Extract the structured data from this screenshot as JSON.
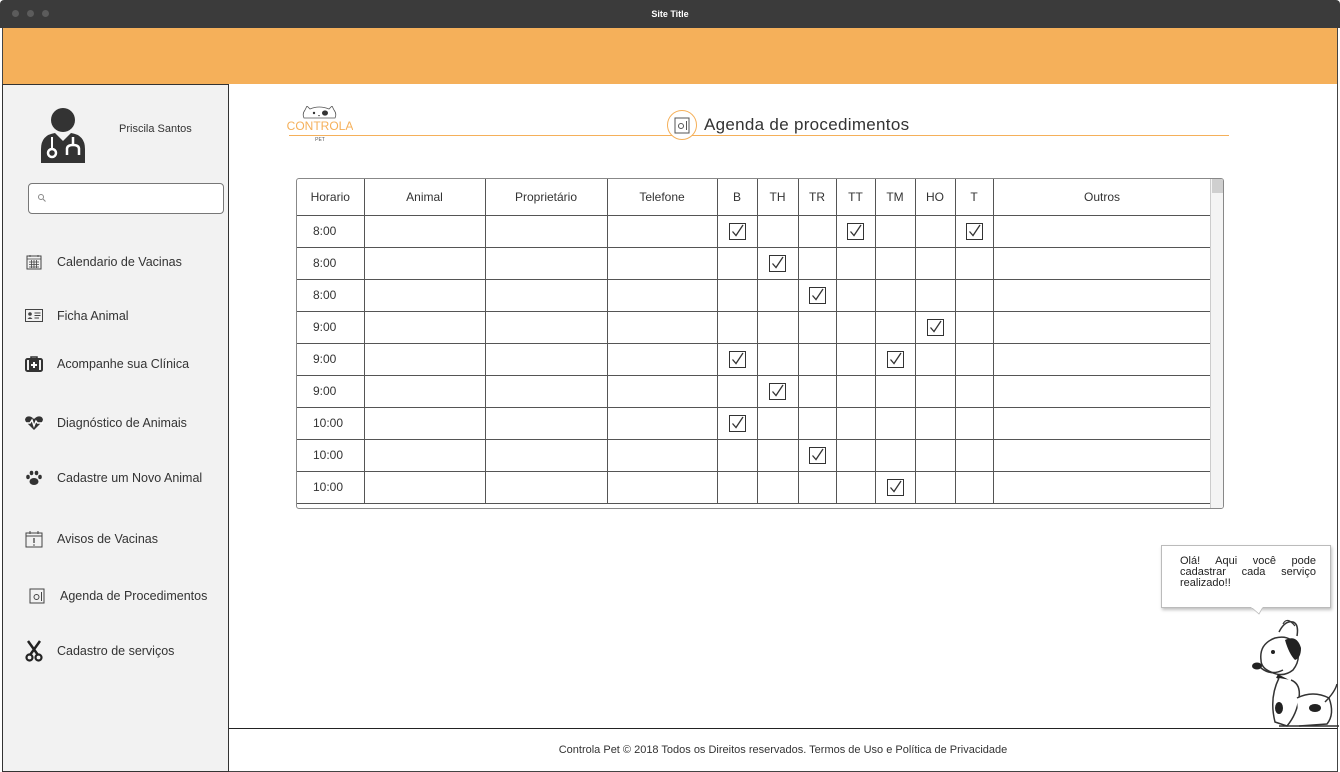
{
  "window": {
    "title": "Site Title"
  },
  "sidebar": {
    "user_name": "Priscila Santos",
    "search_placeholder": "",
    "items": [
      {
        "label": "Calendario de Vacinas",
        "icon": "calendar-grid-icon"
      },
      {
        "label": "Ficha Animal",
        "icon": "id-card-icon"
      },
      {
        "label": "Acompanhe sua Clínica",
        "icon": "medical-kit-icon"
      },
      {
        "label": "Diagnóstico de Animais",
        "icon": "heartbeat-icon"
      },
      {
        "label": "Cadastre um Novo Animal",
        "icon": "paw-icon"
      },
      {
        "label": "Avisos de Vacinas",
        "icon": "calendar-alert-icon"
      },
      {
        "label": "Agenda de Procedimentos",
        "icon": "safe-icon"
      },
      {
        "label": "Cadastro de serviços",
        "icon": "scissors-icon"
      }
    ]
  },
  "main": {
    "logo_text": "CONTROLA",
    "logo_subtext": "PET",
    "page_title": "Agenda de procedimentos",
    "table": {
      "columns": [
        "Horario",
        "Animal",
        "Proprietário",
        "Telefone",
        "B",
        "TH",
        "TR",
        "TT",
        "TM",
        "HO",
        "T",
        "Outros"
      ],
      "rows": [
        {
          "time": "8:00",
          "checks": [
            "B",
            "TT",
            "T"
          ]
        },
        {
          "time": "8:00",
          "checks": [
            "TH"
          ]
        },
        {
          "time": "8:00",
          "checks": [
            "TR"
          ]
        },
        {
          "time": "9:00",
          "checks": [
            "HO"
          ]
        },
        {
          "time": "9:00",
          "checks": [
            "B",
            "TM"
          ]
        },
        {
          "time": "9:00",
          "checks": [
            "TH"
          ]
        },
        {
          "time": "10:00",
          "checks": [
            "B"
          ]
        },
        {
          "time": "10:00",
          "checks": [
            "TR"
          ]
        },
        {
          "time": "10:00",
          "checks": [
            "TM"
          ]
        }
      ]
    },
    "bubble_text": "Olá! Aqui você pode cadastrar cada serviço realizado!!"
  },
  "footer": {
    "text": "Controla Pet © 2018 Todos os Direitos reservados. Termos de Uso e Política de Privacidade"
  },
  "colors": {
    "accent": "#f5b05a",
    "titlebar": "#3b3b3b",
    "sidebar_bg": "#f2f2f2"
  }
}
